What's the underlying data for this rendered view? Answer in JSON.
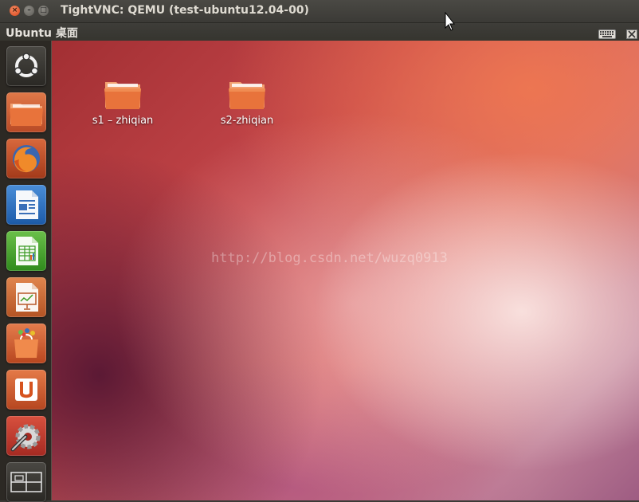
{
  "window": {
    "title": "TightVNC: QEMU (test-ubuntu12.04-00)",
    "buttons": {
      "close_glyph": "×",
      "minimize_glyph": "–",
      "maximize_glyph": "□"
    }
  },
  "panel": {
    "title": "Ubuntu 桌面",
    "indicators": [
      "keyboard-icon",
      "close-icon"
    ]
  },
  "launcher": {
    "items": [
      {
        "name": "dash-home",
        "icon": "ubuntu-logo-icon"
      },
      {
        "name": "home-folder",
        "icon": "folder-icon"
      },
      {
        "name": "firefox",
        "icon": "firefox-icon"
      },
      {
        "name": "libreoffice-writer",
        "icon": "writer-icon"
      },
      {
        "name": "libreoffice-calc",
        "icon": "calc-icon"
      },
      {
        "name": "libreoffice-impress",
        "icon": "impress-icon"
      },
      {
        "name": "software-center",
        "icon": "shopping-bag-icon"
      },
      {
        "name": "ubuntu-one",
        "icon": "ubuntu-one-icon"
      },
      {
        "name": "system-settings",
        "icon": "settings-icon"
      },
      {
        "name": "workspace-switcher",
        "icon": "workspaces-icon"
      }
    ]
  },
  "desktop": {
    "icons": [
      {
        "label": "s1 – zhiqian",
        "icon": "folder-icon"
      },
      {
        "label": "s2-zhiqian",
        "icon": "folder-icon"
      }
    ],
    "watermark": "http://blog.csdn.net/wuzq0913"
  },
  "colors": {
    "panel_bg": "#3c3b37",
    "launcher_bg": "#2c2924",
    "close_button": "#e05a2b",
    "folder_orange": "#e8733b"
  }
}
